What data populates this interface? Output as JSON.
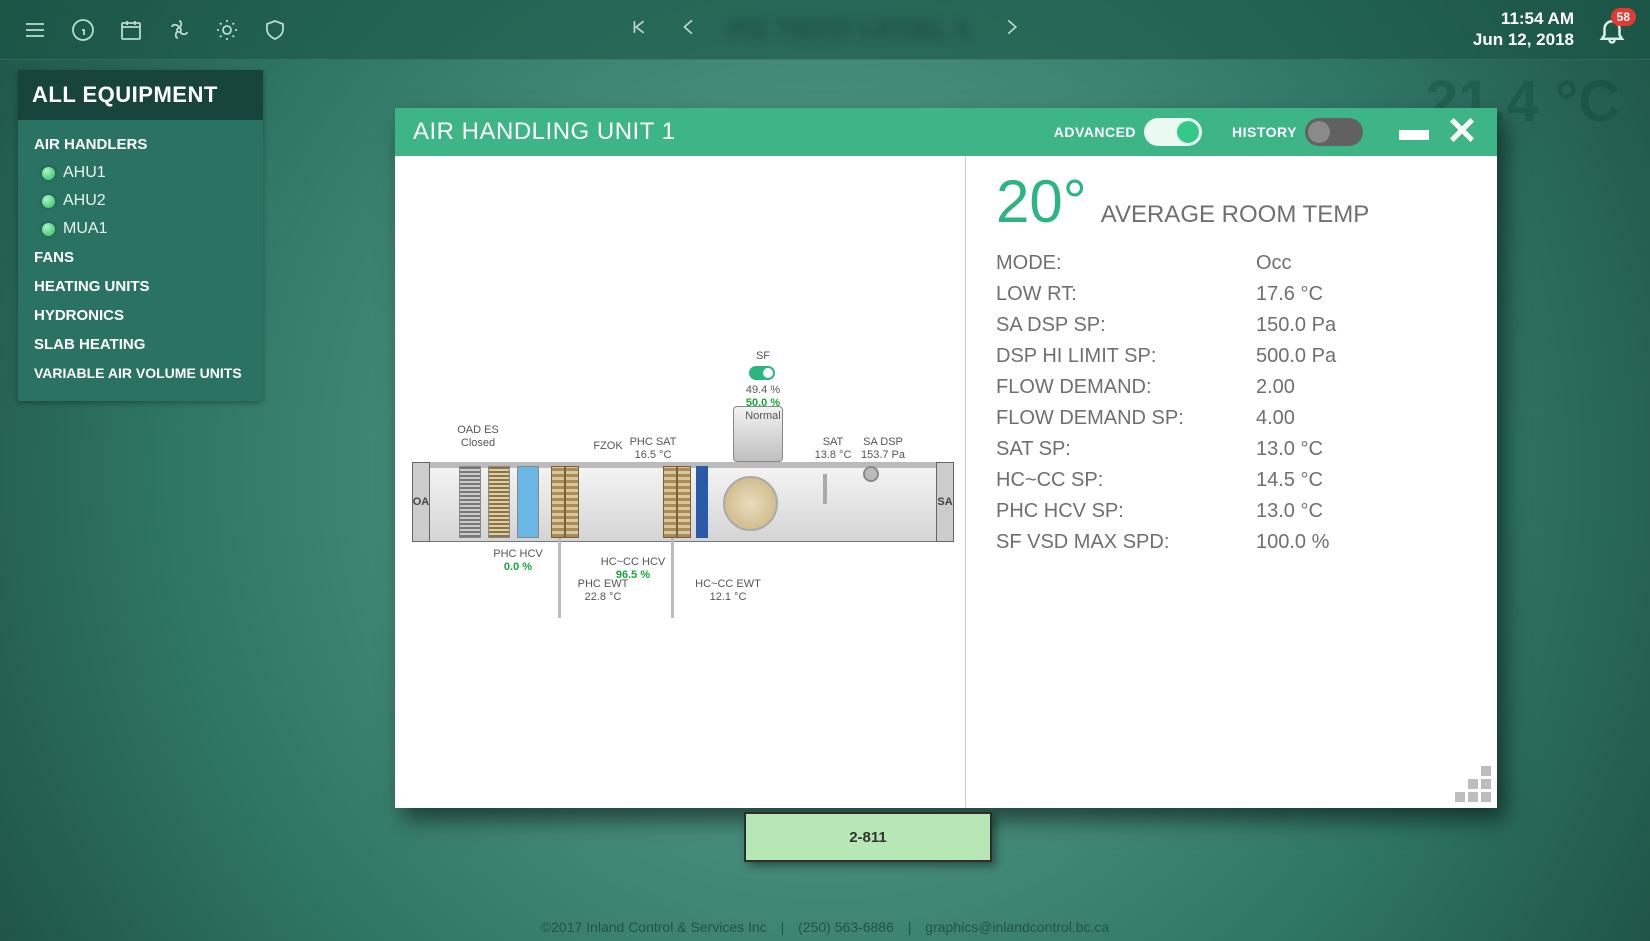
{
  "header": {
    "blur_title": "PG TECH LEVEL 1",
    "time": "11:54 AM",
    "date": "Jun 12, 2018",
    "alert_count": "58"
  },
  "ambient_temp": "21.4 °C",
  "sidebar": {
    "title": "ALL EQUIPMENT",
    "cats": {
      "air_handlers": "AIR HANDLERS",
      "fans": "FANS",
      "heating": "HEATING UNITS",
      "hydronics": "HYDRONICS",
      "slab": "SLAB HEATING",
      "vav": "VARIABLE AIR VOLUME UNITS"
    },
    "ahu_items": {
      "ahu1": "AHU1",
      "ahu2": "AHU2",
      "mua1": "MUA1"
    }
  },
  "modal": {
    "title": "AIR HANDLING UNIT 1",
    "advanced_label": "ADVANCED",
    "history_label": "HISTORY",
    "avg_temp": "20°",
    "avg_label": "AVERAGE ROOM TEMP",
    "rows": [
      {
        "k": "MODE:",
        "v": "Occ"
      },
      {
        "k": "LOW RT:",
        "v": "17.6 °C"
      },
      {
        "k": "SA DSP SP:",
        "v": "150.0 Pa"
      },
      {
        "k": "DSP HI LIMIT SP:",
        "v": "500.0 Pa"
      },
      {
        "k": "FLOW DEMAND:",
        "v": "2.00"
      },
      {
        "k": "FLOW DEMAND SP:",
        "v": "4.00"
      },
      {
        "k": "SAT SP:",
        "v": "13.0 °C"
      },
      {
        "k": "HC~CC SP:",
        "v": "14.5 °C"
      },
      {
        "k": "PHC HCV SP:",
        "v": "13.0 °C"
      },
      {
        "k": "SF VSD MAX SPD:",
        "v": "100.0 %"
      }
    ]
  },
  "diagram": {
    "oa": "OA",
    "sa": "SA",
    "oad_es": "OAD ES",
    "oad_es_val": "Closed",
    "fzok": "FZOK",
    "phc_sat": "PHC SAT",
    "phc_sat_val": "16.5 °C",
    "sf": "SF",
    "sf_val1": "49.4 %",
    "sf_val2": "50.0 %",
    "sf_status": "Normal",
    "sat": "SAT",
    "sat_val": "13.8 °C",
    "sadsp": "SA DSP",
    "sadsp_val": "153.7 Pa",
    "phc_hcv": "PHC HCV",
    "phc_hcv_val": "0.0 %",
    "hccc_hcv": "HC~CC HCV",
    "hccc_hcv_val": "96.5 %",
    "phc_ewt": "PHC EWT",
    "phc_ewt_val": "22.8 °C",
    "hccc_ewt": "HC~CC EWT",
    "hccc_ewt_val": "12.1 °C"
  },
  "floor_tag": "2-811",
  "footer": {
    "copyright": "©2017 Inland Control & Services Inc",
    "phone": "(250) 563-6886",
    "email": "graphics@inlandcontrol.bc.ca"
  }
}
